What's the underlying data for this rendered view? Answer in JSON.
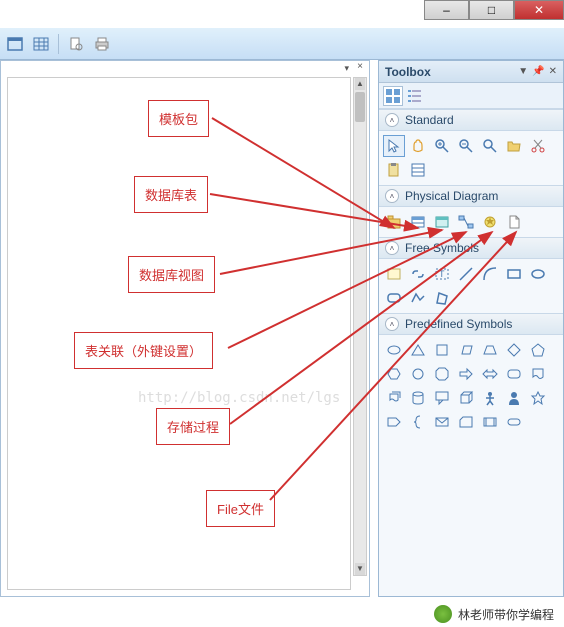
{
  "window": {
    "minimize": "–",
    "maximize": "□",
    "close": "✕"
  },
  "toolbox": {
    "title": "Toolbox",
    "categories": {
      "standard": "Standard",
      "physical": "Physical Diagram",
      "free": "Free Symbols",
      "predefined": "Predefined Symbols"
    }
  },
  "annotations": {
    "a1": "模板包",
    "a2": "数据库表",
    "a3": "数据库视图",
    "a4": "表关联（外键设置）",
    "a5": "存储过程",
    "a6": "File文件"
  },
  "watermark": "http://blog.csdn.net/lgs",
  "footer": {
    "text": "林老师带你学编程"
  }
}
